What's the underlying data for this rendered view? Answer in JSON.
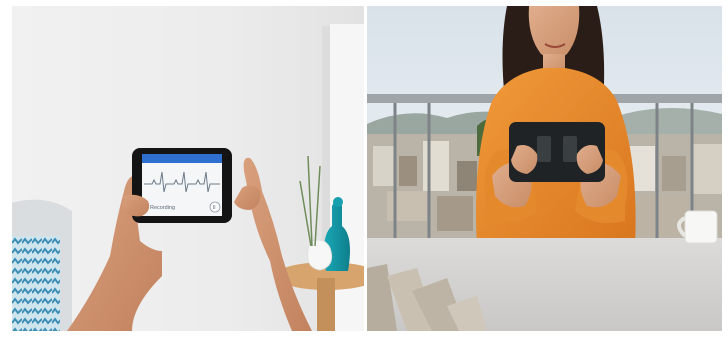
{
  "left_photo": {
    "subject": "hands-holding-smartphone",
    "screen": {
      "app_status_label": "Recording",
      "header_color": "#2f6fd0",
      "waveform_color": "#6d7b88",
      "button_glyph": "II"
    }
  },
  "right_photo": {
    "subject": "woman-holding-phone-on-balcony",
    "palette": {
      "sweater": "#e58a2c",
      "sky": "#e3e9ef",
      "table": "#d6d5d3"
    }
  }
}
